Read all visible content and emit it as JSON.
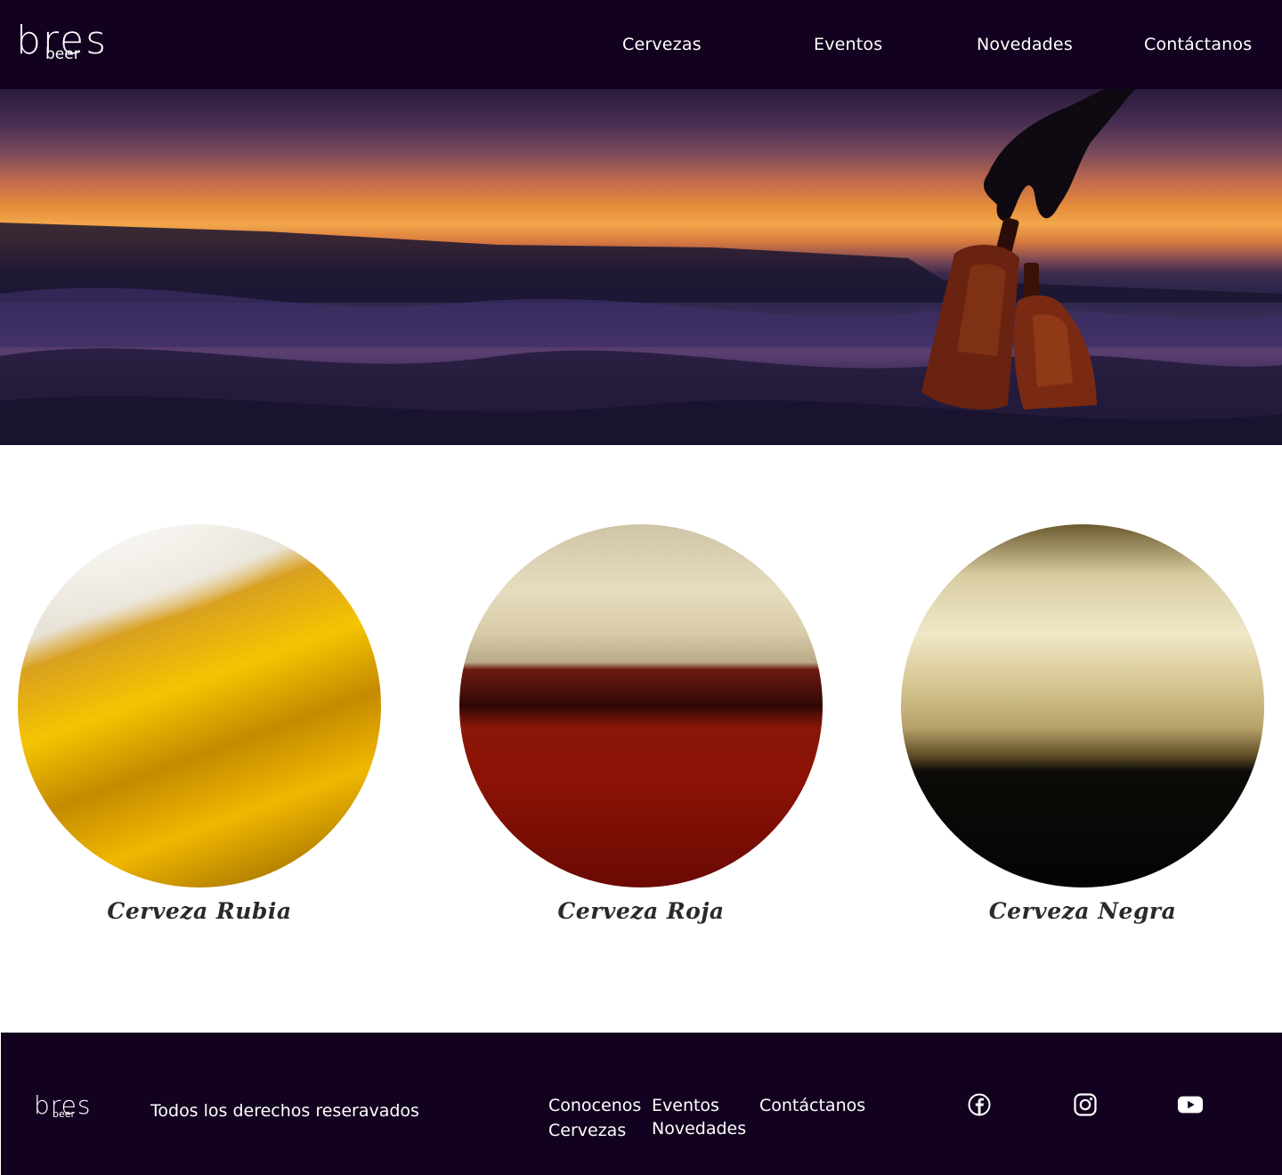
{
  "header": {
    "logo_main": "bres",
    "logo_sub": "beer",
    "nav": [
      "Cervezas",
      "Eventos",
      "Novedades",
      "Contáctanos"
    ]
  },
  "beers": [
    {
      "name": "Cerveza Rubia",
      "color": "#f5c400"
    },
    {
      "name": "Cerveza Roja",
      "color": "#8c1206"
    },
    {
      "name": "Cerveza Negra",
      "color": "#0d0b08"
    }
  ],
  "footer": {
    "logo_main": "bres",
    "logo_sub": "beer",
    "rights": "Todos los derechos reseravados",
    "links": [
      "Conocenos",
      "Cervezas",
      "Eventos",
      "Novedades",
      "Contáctanos"
    ],
    "social_icons": [
      "facebook-icon",
      "instagram-icon",
      "youtube-icon"
    ]
  },
  "colors": {
    "brand_dark": "#12021f",
    "text_light": "#ffffff",
    "beer_label": "#2a2a2a"
  }
}
